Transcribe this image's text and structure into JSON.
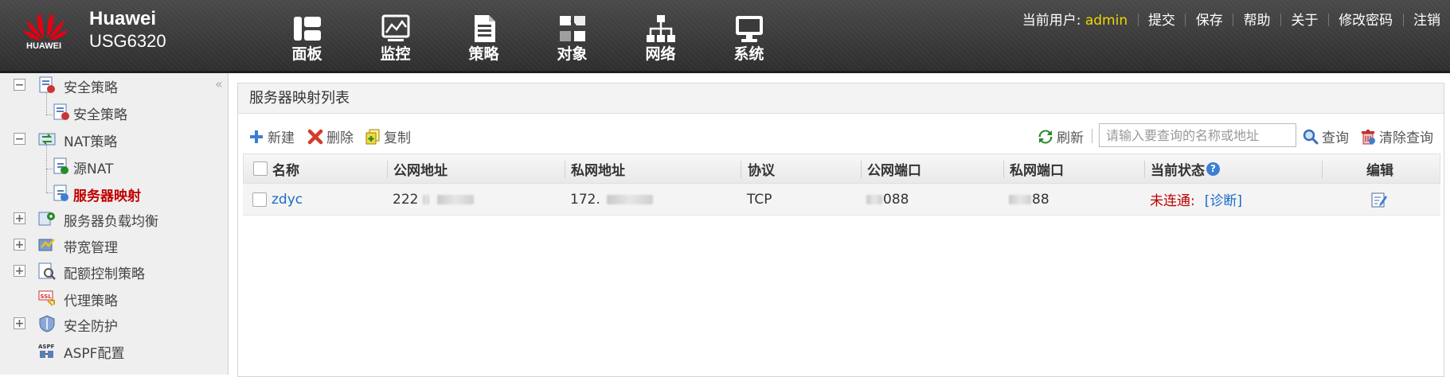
{
  "brand": {
    "logo_text": "HUAWEI",
    "name": "Huawei",
    "model": "USG6320"
  },
  "nav": [
    {
      "label": "面板",
      "icon": "dashboard-icon"
    },
    {
      "label": "监控",
      "icon": "monitor-icon"
    },
    {
      "label": "策略",
      "icon": "policy-document-icon",
      "active": true
    },
    {
      "label": "对象",
      "icon": "object-icon"
    },
    {
      "label": "网络",
      "icon": "network-icon"
    },
    {
      "label": "系统",
      "icon": "system-icon"
    }
  ],
  "userbar": {
    "current_user_label": "当前用户:",
    "username": "admin",
    "links": [
      "提交",
      "保存",
      "帮助",
      "关于",
      "修改密码",
      "注销"
    ]
  },
  "sidebar": {
    "collapse_glyph": "«",
    "items": [
      {
        "label": "安全策略",
        "level": 0,
        "toggle": "−"
      },
      {
        "label": "安全策略",
        "level": 1
      },
      {
        "label": "NAT策略",
        "level": 0,
        "toggle": "−"
      },
      {
        "label": "源NAT",
        "level": 1
      },
      {
        "label": "服务器映射",
        "level": 1,
        "selected": true
      },
      {
        "label": "服务器负载均衡",
        "level": 0,
        "toggle": "+"
      },
      {
        "label": "带宽管理",
        "level": 0,
        "toggle": "+"
      },
      {
        "label": "配额控制策略",
        "level": 0,
        "toggle": "+"
      },
      {
        "label": "代理策略",
        "level": 0
      },
      {
        "label": "安全防护",
        "level": 0,
        "toggle": "+"
      },
      {
        "label": "ASPF配置",
        "level": 0
      }
    ]
  },
  "main": {
    "title": "服务器映射列表",
    "toolbar": {
      "new_label": "新建",
      "delete_label": "删除",
      "copy_label": "复制",
      "refresh_label": "刷新",
      "search_placeholder": "请输入要查询的名称或地址",
      "search_label": "查询",
      "clear_label": "清除查询"
    },
    "table": {
      "columns": [
        "名称",
        "公网地址",
        "私网地址",
        "协议",
        "公网端口",
        "私网端口",
        "当前状态",
        "编辑"
      ],
      "rows": [
        {
          "name": "zdyc",
          "public_ip": "222",
          "private_ip": "172.",
          "protocol": "TCP",
          "public_port": "088",
          "private_port": "88",
          "status": "未连通:",
          "diagnose": "[诊断]"
        }
      ]
    }
  },
  "colors": {
    "accent_red": "#c00000",
    "link_blue": "#1b6ac9",
    "user_yellow": "#f0d800"
  }
}
